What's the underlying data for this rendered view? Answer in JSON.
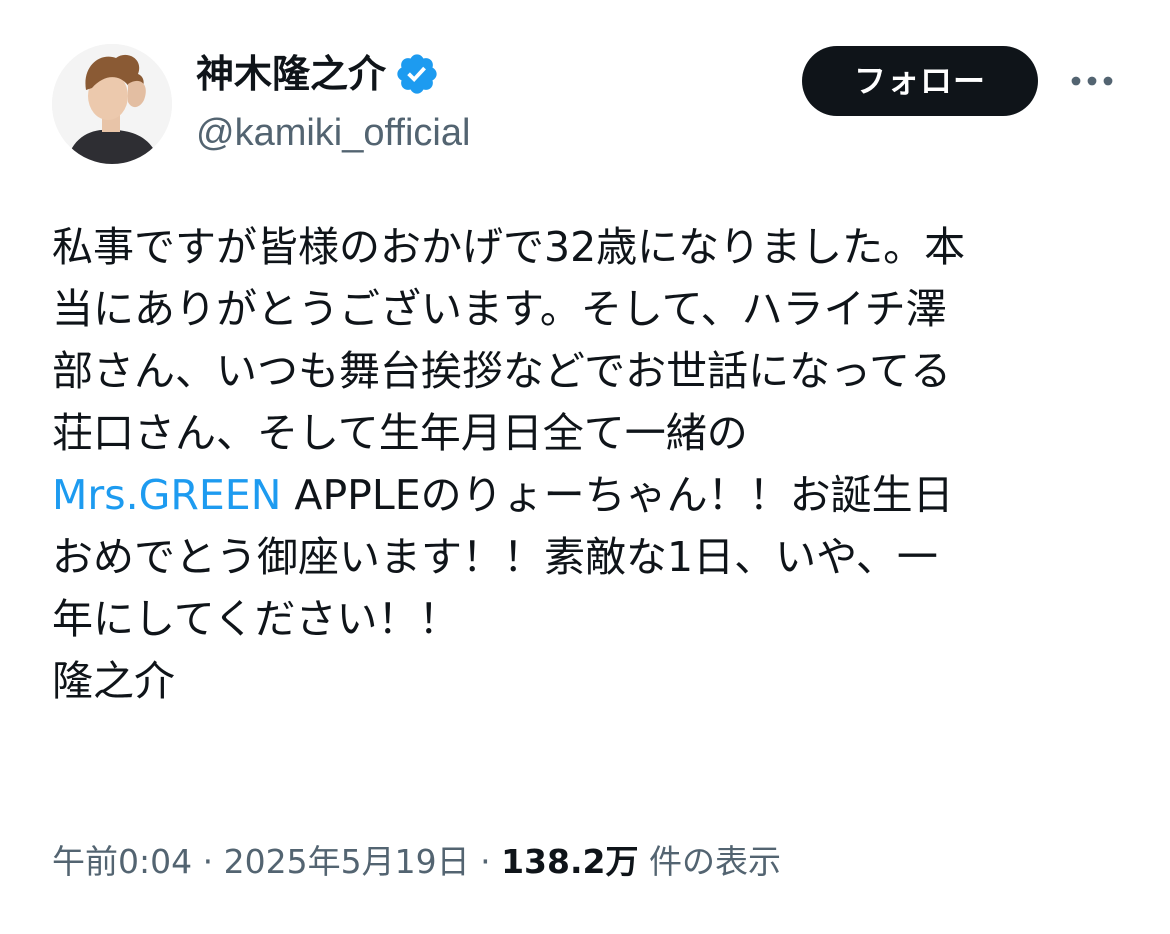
{
  "author": {
    "display_name": "神木隆之介",
    "handle": "@kamiki_official",
    "verified_icon": "verified-badge-icon",
    "verified_color": "#1d9bf0"
  },
  "actions": {
    "follow_label": "フォロー",
    "more_icon": "more-horizontal-icon"
  },
  "tweet": {
    "lines": [
      "私事ですが皆様のおかげで32歳になりました。本",
      "当にありがとうございます。そして、ハライチ澤",
      "部さん、いつも舞台挨拶などでお世話になってる",
      "荘口さん、そして生年月日全て一緒の"
    ],
    "mention": "Mrs.GREEN",
    "line5_rest": " APPLEのりょーちゃん！！お誕生日",
    "lines_after": [
      "おめでとう御座います！！素敵な1日、いや、一",
      "年にしてください！！",
      "隆之介"
    ],
    "link_color": "#1d9bf0"
  },
  "meta": {
    "time": "午前0:04",
    "separator": " · ",
    "date": "2025年5月19日",
    "views_count": "138.2万",
    "views_label": " 件の表示"
  }
}
